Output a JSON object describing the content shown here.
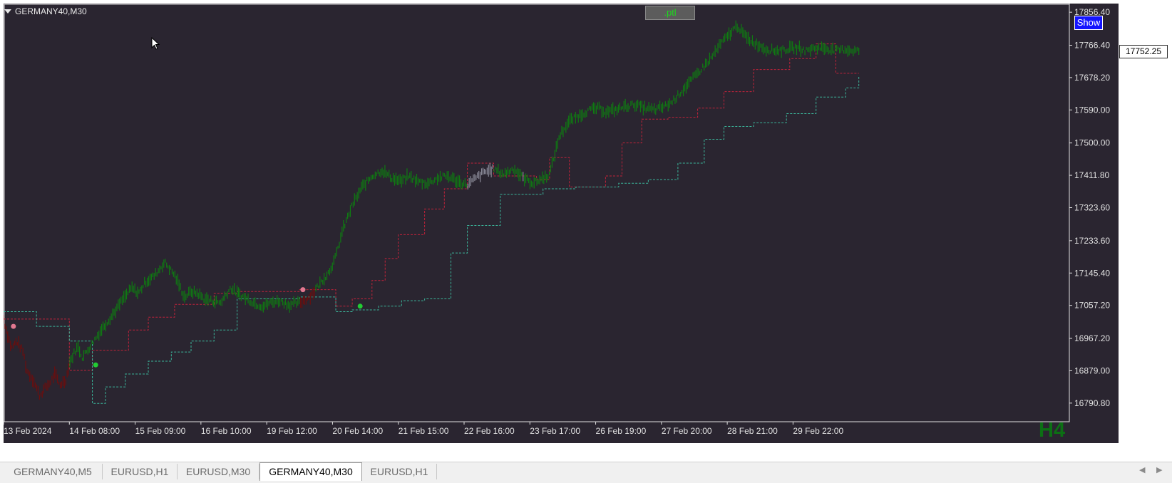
{
  "window": {
    "symbol_title": "GERMANY40,M30",
    "ptl_button": ".ptl",
    "show_button": "Show",
    "timeframe_label": "H4",
    "current_price": "17752.25"
  },
  "colors": {
    "background": "#2a2530",
    "axis": "#e0e0e0",
    "bull_bar": "#0f7a12",
    "bear_bar": "#6b0e0e",
    "neutral_bar": "#8a8a98",
    "upper_band": "#c0233a",
    "lower_band": "#3bb59a",
    "buy_dot": "#22cc33",
    "sell_dot": "#e27890"
  },
  "chart_data": {
    "type": "candlestick",
    "title": "GERMANY40,M30",
    "ylim": [
      16740,
      17880
    ],
    "y_ticks": [
      "17856.40",
      "17766.40",
      "17678.20",
      "17590.00",
      "17500.00",
      "17411.80",
      "17323.60",
      "17233.60",
      "17145.40",
      "17057.20",
      "16967.20",
      "16879.00",
      "16790.80"
    ],
    "x_ticks": [
      "13 Feb 2024",
      "14 Feb 08:00",
      "15 Feb 09:00",
      "16 Feb 10:00",
      "19 Feb 12:00",
      "20 Feb 14:00",
      "21 Feb 15:00",
      "22 Feb 16:00",
      "23 Feb 17:00",
      "26 Feb 19:00",
      "27 Feb 20:00",
      "28 Feb 21:00",
      "29 Feb 22:00"
    ],
    "price_series": {
      "x": [
        0,
        0.05,
        0.12,
        0.2,
        0.3,
        0.35,
        0.45,
        0.55,
        0.62,
        0.7,
        0.78,
        0.85,
        0.95,
        1.0,
        1.08,
        1.13,
        1.2,
        1.35,
        1.5,
        1.65,
        1.8,
        1.95,
        2.05,
        2.15,
        2.3,
        2.45,
        2.6,
        2.75,
        2.85,
        2.95,
        3.05,
        3.15,
        3.3,
        3.45,
        3.55,
        3.7,
        3.85,
        3.95,
        4.05,
        4.2,
        4.35,
        4.5,
        4.65,
        4.8,
        4.95,
        5.05,
        5.15,
        5.3,
        5.45,
        5.6,
        5.75,
        5.9,
        6.05,
        6.15,
        6.3,
        6.45,
        6.6,
        6.75,
        6.9,
        7.05,
        7.15,
        7.3,
        7.45,
        7.6,
        7.75,
        7.9,
        8.05,
        8.15,
        8.3,
        8.45,
        8.6,
        8.75,
        8.9,
        9.05,
        9.15,
        9.3,
        9.45,
        9.6,
        9.75,
        9.9,
        10.05,
        10.15,
        10.3,
        10.45,
        10.6,
        10.75,
        10.9,
        11.05,
        11.15,
        11.3,
        11.45,
        11.6,
        11.75,
        11.9,
        12.05,
        12.2,
        12.35,
        12.5,
        12.65,
        12.8,
        12.9,
        13.0
      ],
      "y": [
        17020,
        16985,
        16940,
        16960,
        16930,
        16880,
        16855,
        16810,
        16830,
        16845,
        16870,
        16840,
        16855,
        16900,
        16930,
        16945,
        16915,
        16955,
        16995,
        17030,
        17070,
        17105,
        17090,
        17120,
        17140,
        17175,
        17140,
        17080,
        17095,
        17090,
        17075,
        17070,
        17065,
        17105,
        17090,
        17075,
        17060,
        17055,
        17065,
        17070,
        17058,
        17065,
        17080,
        17115,
        17150,
        17190,
        17260,
        17330,
        17380,
        17410,
        17425,
        17405,
        17395,
        17410,
        17395,
        17390,
        17405,
        17410,
        17395,
        17385,
        17400,
        17420,
        17430,
        17415,
        17430,
        17405,
        17390,
        17400,
        17415,
        17520,
        17560,
        17575,
        17590,
        17595,
        17585,
        17590,
        17600,
        17605,
        17595,
        17590,
        17600,
        17610,
        17640,
        17670,
        17700,
        17730,
        17770,
        17800,
        17820,
        17785,
        17770,
        17755,
        17752,
        17755,
        17760,
        17752,
        17760,
        17758,
        17752,
        17755,
        17752,
        17752
      ]
    },
    "upper_band_steps": [
      [
        0,
        17020
      ],
      [
        1.0,
        16880
      ],
      [
        1.35,
        16935
      ],
      [
        1.9,
        16990
      ],
      [
        2.2,
        17025
      ],
      [
        2.6,
        17060
      ],
      [
        3.2,
        17090
      ],
      [
        3.55,
        17095
      ],
      [
        4.5,
        17100
      ],
      [
        5.05,
        17055
      ],
      [
        5.3,
        17075
      ],
      [
        5.6,
        17125
      ],
      [
        5.8,
        17185
      ],
      [
        6.0,
        17250
      ],
      [
        6.4,
        17320
      ],
      [
        6.7,
        17375
      ],
      [
        7.05,
        17445
      ],
      [
        7.45,
        17410
      ],
      [
        8.1,
        17400
      ],
      [
        8.3,
        17460
      ],
      [
        8.6,
        17380
      ],
      [
        9.15,
        17410
      ],
      [
        9.4,
        17500
      ],
      [
        9.7,
        17565
      ],
      [
        10.1,
        17570
      ],
      [
        10.55,
        17595
      ],
      [
        10.95,
        17640
      ],
      [
        11.4,
        17700
      ],
      [
        11.95,
        17730
      ],
      [
        12.35,
        17770
      ],
      [
        12.65,
        17690
      ],
      [
        13.0,
        17690
      ]
    ],
    "lower_band_steps": [
      [
        0,
        17040
      ],
      [
        0.5,
        17000
      ],
      [
        1.0,
        16960
      ],
      [
        1.35,
        16790
      ],
      [
        1.55,
        16835
      ],
      [
        1.85,
        16870
      ],
      [
        2.2,
        16905
      ],
      [
        2.55,
        16930
      ],
      [
        2.85,
        16960
      ],
      [
        3.2,
        16990
      ],
      [
        3.55,
        17075
      ],
      [
        4.5,
        17080
      ],
      [
        5.05,
        17040
      ],
      [
        5.3,
        17045
      ],
      [
        5.7,
        17055
      ],
      [
        6.05,
        17070
      ],
      [
        6.4,
        17075
      ],
      [
        6.8,
        17200
      ],
      [
        7.05,
        17275
      ],
      [
        7.55,
        17360
      ],
      [
        8.2,
        17375
      ],
      [
        8.7,
        17380
      ],
      [
        9.35,
        17390
      ],
      [
        9.8,
        17400
      ],
      [
        10.25,
        17445
      ],
      [
        10.65,
        17510
      ],
      [
        10.95,
        17545
      ],
      [
        11.4,
        17555
      ],
      [
        11.9,
        17580
      ],
      [
        12.35,
        17625
      ],
      [
        12.8,
        17650
      ],
      [
        13.0,
        17680
      ]
    ],
    "buy_signals": [
      {
        "x": 1.4,
        "y": 16895
      },
      {
        "x": 5.42,
        "y": 17055
      }
    ],
    "sell_signals": [
      {
        "x": 0.15,
        "y": 17000
      },
      {
        "x": 4.55,
        "y": 17100
      }
    ]
  },
  "tabs": [
    {
      "label": "GERMANY40,M5",
      "active": false
    },
    {
      "label": "EURUSD,H1",
      "active": false
    },
    {
      "label": "EURUSD,M30",
      "active": false
    },
    {
      "label": "GERMANY40,M30",
      "active": true
    },
    {
      "label": "EURUSD,H1",
      "active": false
    }
  ]
}
